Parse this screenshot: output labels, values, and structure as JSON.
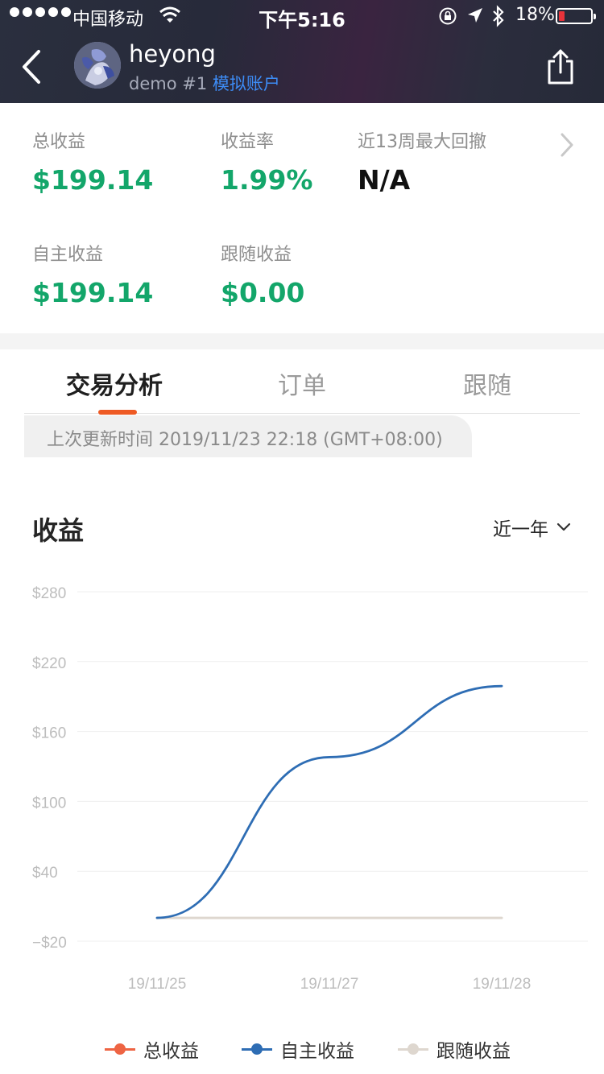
{
  "status_bar": {
    "carrier": "中国移动",
    "time": "下午5:16",
    "battery_percent": "18%",
    "battery_level": 0.18,
    "battery_color": "#e8333a"
  },
  "header": {
    "username": "heyong",
    "account_label": "demo #1",
    "account_type": "模拟账户"
  },
  "stats": {
    "total_profit": {
      "label": "总收益",
      "value": "$199.14"
    },
    "profit_rate": {
      "label": "收益率",
      "value": "1.99%"
    },
    "max_drawdown": {
      "label": "近13周最大回撤",
      "value": "N/A"
    },
    "own_profit": {
      "label": "自主收益",
      "value": "$199.14"
    },
    "follow_profit": {
      "label": "跟随收益",
      "value": "$0.00"
    }
  },
  "tabs": [
    {
      "label": "交易分析",
      "active": true
    },
    {
      "label": "订单",
      "active": false
    },
    {
      "label": "跟随",
      "active": false
    }
  ],
  "update_info": "上次更新时间 2019/11/23 22:18 (GMT+08:00)",
  "profit_section": {
    "title": "收益",
    "range": "近一年"
  },
  "colors": {
    "profit_green": "#13a66a",
    "tab_accent": "#ee5a24",
    "link_blue": "#3d8cf5",
    "series_total": "#ee6443",
    "series_own": "#2e6db4",
    "series_follow": "#ded7cf"
  },
  "chart_data": {
    "type": "line",
    "y_ticks": [
      "$280",
      "$220",
      "$160",
      "$100",
      "$40",
      "−$20"
    ],
    "ylim": [
      -20,
      280
    ],
    "x_ticks": [
      "19/11/25",
      "19/11/27",
      "19/11/28"
    ],
    "grid": true,
    "legend_position": "bottom",
    "series": [
      {
        "name": "总收益",
        "color": "#ee6443",
        "points": []
      },
      {
        "name": "自主收益",
        "color": "#2e6db4",
        "points": [
          {
            "x": "19/11/25",
            "y": 0
          },
          {
            "x": "19/11/27",
            "y": 138
          },
          {
            "x": "19/11/28",
            "y": 199
          }
        ]
      },
      {
        "name": "跟随收益",
        "color": "#ded7cf",
        "points": [
          {
            "x": "19/11/25",
            "y": 0
          },
          {
            "x": "19/11/27",
            "y": 0
          },
          {
            "x": "19/11/28",
            "y": 0
          }
        ]
      }
    ]
  }
}
